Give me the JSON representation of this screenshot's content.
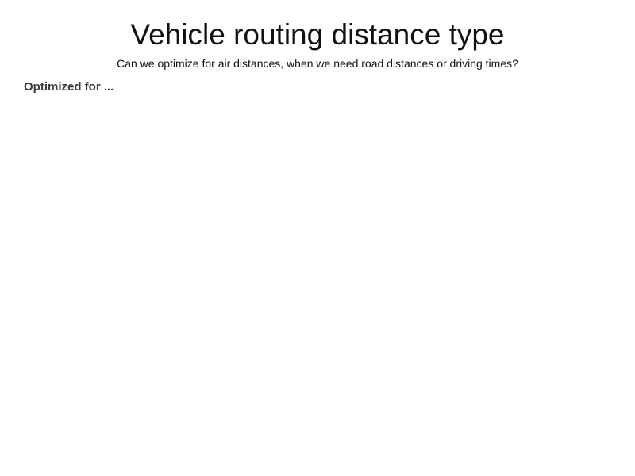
{
  "page": {
    "title": "Vehicle routing distance type",
    "subtitle": "Can we optimize for air distances, when we need road distances or driving times?"
  },
  "section": {
    "label": "Optimized for ..."
  },
  "colors": {
    "background": "#ffffff",
    "title_text": "#111111",
    "section_label_text": "#3a3a3a"
  }
}
